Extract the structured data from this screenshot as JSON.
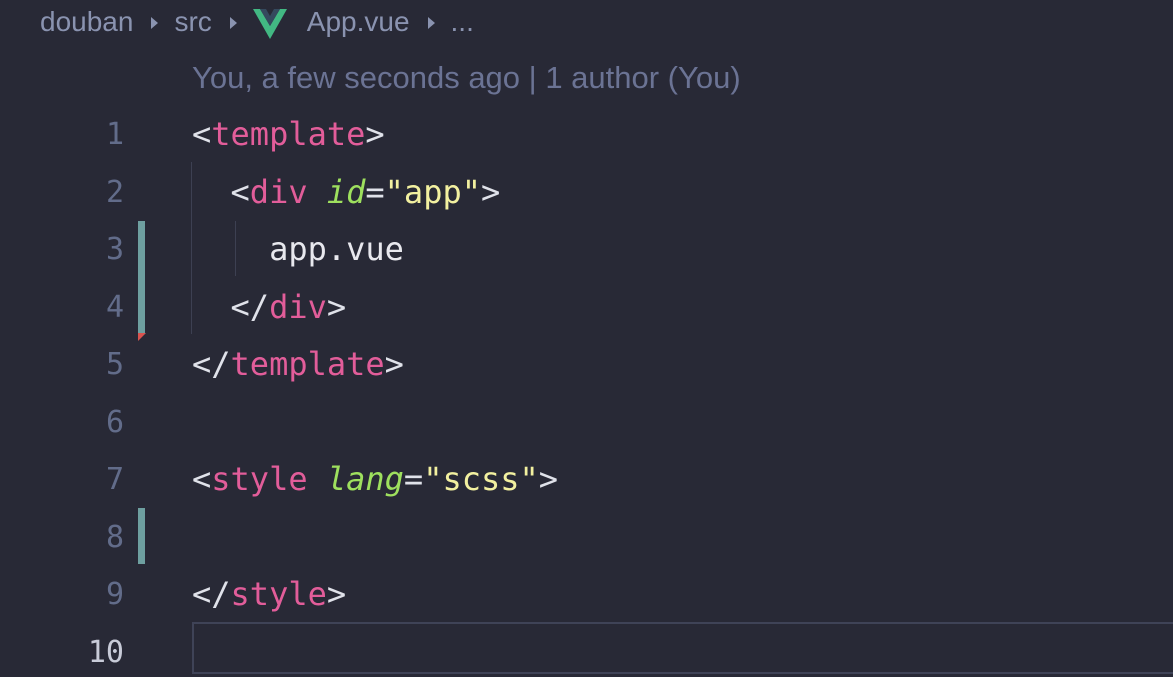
{
  "breadcrumb": {
    "items": [
      "douban",
      "src",
      "App.vue",
      "..."
    ]
  },
  "codelens": {
    "text": "You, a few seconds ago | 1 author (You)"
  },
  "lines": [
    {
      "num": "1",
      "tokens": [
        [
          "punc",
          "<"
        ],
        [
          "tag",
          "template"
        ],
        [
          "punc",
          ">"
        ]
      ]
    },
    {
      "num": "2",
      "tokens": [
        [
          "punc",
          "  <"
        ],
        [
          "tag",
          "div"
        ],
        [
          "punc",
          " "
        ],
        [
          "attr",
          "id"
        ],
        [
          "punc",
          "="
        ],
        [
          "str",
          "\"app\""
        ],
        [
          "punc",
          ">"
        ]
      ]
    },
    {
      "num": "3",
      "tokens": [
        [
          "txt",
          "    app.vue"
        ]
      ]
    },
    {
      "num": "4",
      "tokens": [
        [
          "punc",
          "  </"
        ],
        [
          "tag",
          "div"
        ],
        [
          "punc",
          ">"
        ]
      ]
    },
    {
      "num": "5",
      "tokens": [
        [
          "punc",
          "</"
        ],
        [
          "tag",
          "template"
        ],
        [
          "punc",
          ">"
        ]
      ]
    },
    {
      "num": "6",
      "tokens": []
    },
    {
      "num": "7",
      "tokens": [
        [
          "punc",
          "<"
        ],
        [
          "tag",
          "style"
        ],
        [
          "punc",
          " "
        ],
        [
          "attr",
          "lang"
        ],
        [
          "punc",
          "="
        ],
        [
          "str",
          "\"scss\""
        ],
        [
          "punc",
          ">"
        ]
      ]
    },
    {
      "num": "8",
      "tokens": []
    },
    {
      "num": "9",
      "tokens": [
        [
          "punc",
          "</"
        ],
        [
          "tag",
          "style"
        ],
        [
          "punc",
          ">"
        ]
      ]
    },
    {
      "num": "10",
      "tokens": [],
      "active": true
    }
  ],
  "colors": {
    "background": "#282936",
    "tag": "#e25d9a",
    "attribute": "#9ee05e",
    "string": "#f2f0a0",
    "vue_green": "#42b883"
  },
  "icons": {
    "file_icon": "vue-logo-icon",
    "separator": "chevron-right-icon"
  }
}
